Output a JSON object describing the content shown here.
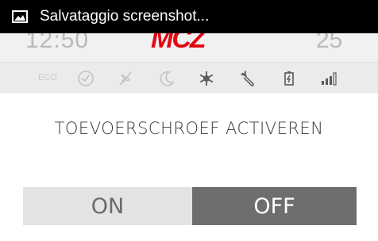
{
  "header": {
    "clock": "12:50",
    "logo": "MCZ",
    "temperature": "25"
  },
  "toast": {
    "icon": "image-icon",
    "text": "Salvataggio screenshot..."
  },
  "status_bar": {
    "eco_label": "ECO",
    "icons": [
      "timer-icon",
      "fan-off-icon",
      "moon-icon",
      "snowflake-icon",
      "wrench-icon",
      "battery-icon",
      "signal-icon"
    ]
  },
  "page": {
    "title": "TOEVOERSCHROEF ACTIVEREN"
  },
  "toggle": {
    "on_label": "ON",
    "off_label": "OFF",
    "selected": "OFF"
  },
  "colors": {
    "logo": "#e30613",
    "selected_button": "#6e6e6e",
    "unselected_button": "#e3e3e3"
  }
}
